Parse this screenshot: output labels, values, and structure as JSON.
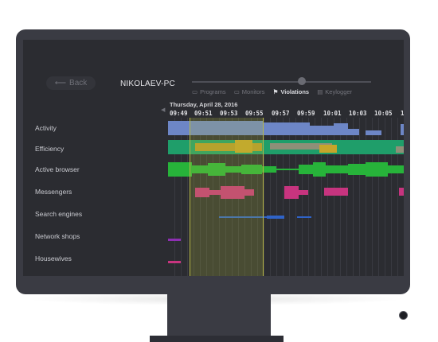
{
  "nav": {
    "back_label": "Back"
  },
  "computer_name": "NIKOLAEV-PC",
  "tabs": [
    {
      "label": "Programs",
      "icon": "folder-icon",
      "active": false
    },
    {
      "label": "Monitors",
      "icon": "monitor-icon",
      "active": false
    },
    {
      "label": "Violations",
      "icon": "flag-icon",
      "active": true
    },
    {
      "label": "Keylogger",
      "icon": "keyboard-icon",
      "active": false
    }
  ],
  "timeline": {
    "date": "Thursday, April 28, 2016",
    "times": [
      "09:49",
      "09:51",
      "09:53",
      "09:55",
      "09:57",
      "09:59",
      "10:01",
      "10:03",
      "10:05",
      "1"
    ]
  },
  "rows": [
    {
      "label": "Activity"
    },
    {
      "label": "Efficiency"
    },
    {
      "label": "Active browser"
    },
    {
      "label": "Messengers"
    },
    {
      "label": "Search engines"
    },
    {
      "label": "Network shops"
    },
    {
      "label": "Housewives"
    }
  ],
  "colors": {
    "activity": "#6d86c6",
    "efficiency_green": "#1f9e6a",
    "efficiency_gold": "#b89a2a",
    "browser": "#27b33a",
    "messengers": "#c7347f",
    "search": "#2f63c8",
    "shops": "#8d2fb2",
    "housewives": "#c7347f",
    "selection": "#b8b846"
  }
}
